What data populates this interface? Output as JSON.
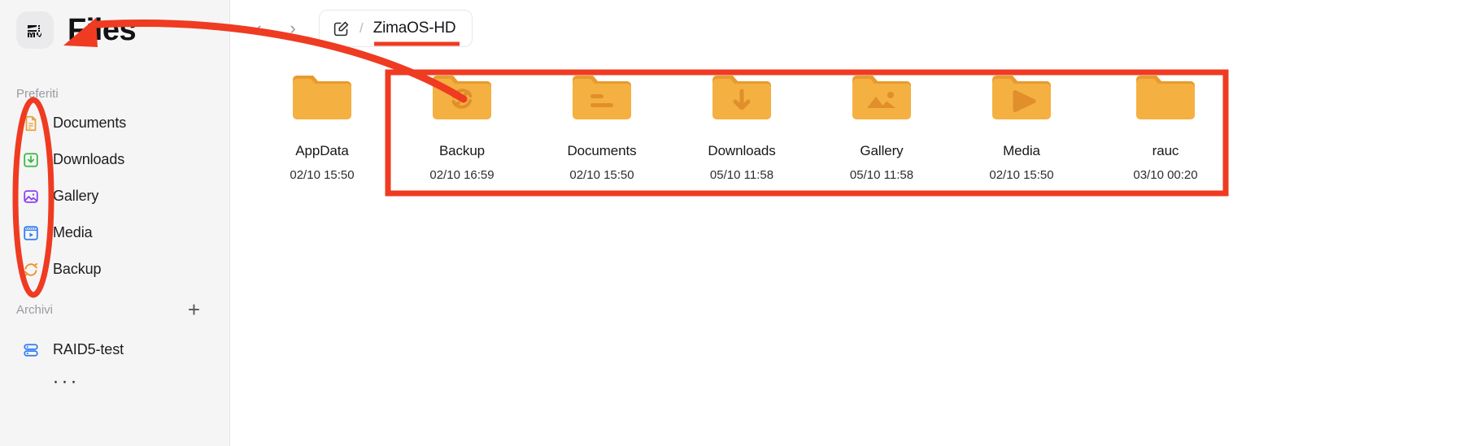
{
  "app": {
    "title": "Files",
    "logo_icon": "zima-logo-icon"
  },
  "sidebar": {
    "favorites_label": "Preferiti",
    "favorites": [
      {
        "label": "Documents",
        "icon": "document-icon",
        "color": "#e9a33b"
      },
      {
        "label": "Downloads",
        "icon": "download-icon",
        "color": "#35b93f"
      },
      {
        "label": "Gallery",
        "icon": "image-icon",
        "color": "#8a3ff0"
      },
      {
        "label": "Media",
        "icon": "video-icon",
        "color": "#2f7bf6"
      },
      {
        "label": "Backup",
        "icon": "sync-icon",
        "color": "#f08c1e"
      }
    ],
    "storage_label": "Archivi",
    "add_storage_label": "+",
    "storage": [
      {
        "label": "RAID5-test",
        "icon": "storage-icon",
        "color": "#2f7bf6"
      }
    ],
    "more_label": "···"
  },
  "toolbar": {
    "back_label": "‹",
    "forward_label": "›",
    "edit_icon": "edit-square-icon",
    "separator": "/",
    "path_label": "ZimaOS-HD"
  },
  "files": [
    {
      "name": "AppData",
      "time": "02/10 15:50",
      "glyph": "none"
    },
    {
      "name": "Backup",
      "time": "02/10 16:59",
      "glyph": "sync"
    },
    {
      "name": "Documents",
      "time": "02/10 15:50",
      "glyph": "lines"
    },
    {
      "name": "Downloads",
      "time": "05/10 11:58",
      "glyph": "arrow-down"
    },
    {
      "name": "Gallery",
      "time": "05/10 11:58",
      "glyph": "image"
    },
    {
      "name": "Media",
      "time": "02/10 15:50",
      "glyph": "play"
    },
    {
      "name": "rauc",
      "time": "03/10 00:20",
      "glyph": "none"
    }
  ],
  "annotations": {
    "color": "#ef3b21",
    "underline_target": "ZimaOS-HD",
    "ellipse_target": "favorites-list",
    "rectangle_target": "folders-backup-to-media",
    "arrow_from": "breadcrumb-area",
    "arrow_to": "favorites-list"
  },
  "colors": {
    "folder_body": "#f5b042",
    "folder_tab": "#e89b2e",
    "folder_glyph": "#e08f2b",
    "sidebar_bg": "#f5f5f6",
    "accent_red": "#ef3b21"
  }
}
